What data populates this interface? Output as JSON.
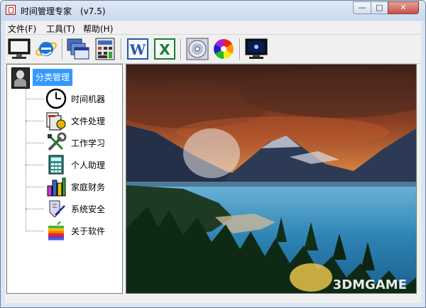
{
  "window": {
    "title": "时间管理专家　(v7.5)"
  },
  "menu": [
    {
      "label": "文件(F)"
    },
    {
      "label": "工具(T)"
    },
    {
      "label": "帮助(H)"
    }
  ],
  "toolbar": [
    {
      "icon": "monitor-icon"
    },
    {
      "icon": "internet-explorer-icon"
    },
    {
      "icon": "stacked-windows-icon"
    },
    {
      "icon": "calculator-grid-icon"
    },
    {
      "icon": "word-icon",
      "glyph": "W"
    },
    {
      "icon": "excel-icon",
      "glyph": "X"
    },
    {
      "icon": "cd-disc-icon"
    },
    {
      "icon": "color-wheel-icon"
    },
    {
      "icon": "screen-display-icon"
    }
  ],
  "tree": {
    "root": {
      "label": "分类管理",
      "icon": "user-photo-icon"
    },
    "items": [
      {
        "label": "时间机器",
        "icon": "clock-icon"
      },
      {
        "label": "文件处理",
        "icon": "files-icon"
      },
      {
        "label": "工作学习",
        "icon": "tools-icon"
      },
      {
        "label": "个人助理",
        "icon": "calculator-icon"
      },
      {
        "label": "家庭财务",
        "icon": "bar-chart-icon"
      },
      {
        "label": "系统安全",
        "icon": "security-icon"
      },
      {
        "label": "关于软件",
        "icon": "apple-icon"
      }
    ]
  },
  "watermark": {
    "text": "3DMGAME"
  },
  "colors": {
    "selection": "#3399ff",
    "close_button": "#c75050"
  }
}
